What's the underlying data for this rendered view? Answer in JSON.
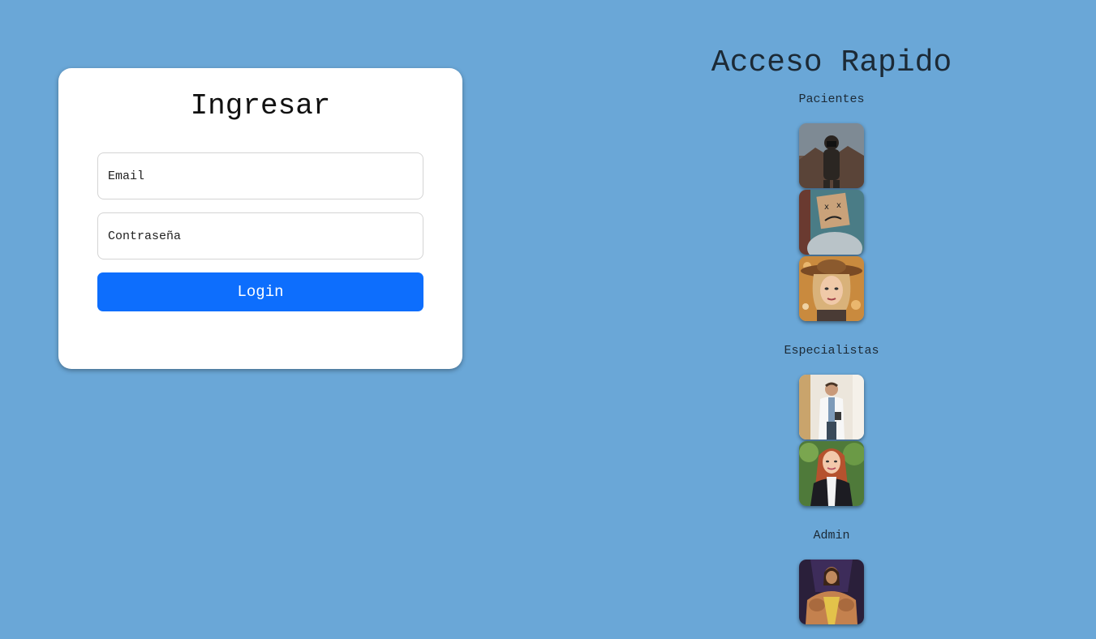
{
  "login": {
    "title": "Ingresar",
    "email_placeholder": "Email",
    "password_placeholder": "Contraseña",
    "submit_label": "Login"
  },
  "quick_access": {
    "title": "Acceso Rapido",
    "sections": [
      {
        "label": "Pacientes"
      },
      {
        "label": "Especialistas"
      },
      {
        "label": "Admin"
      }
    ]
  },
  "colors": {
    "background": "#6aa7d7",
    "primary_button": "#0d6efd",
    "card": "#ffffff"
  }
}
